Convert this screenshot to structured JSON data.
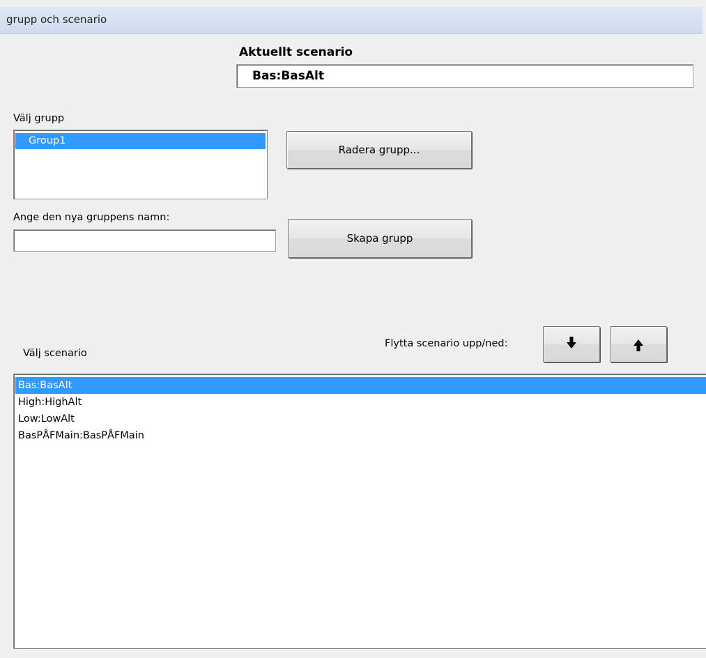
{
  "window": {
    "title": "grupp och scenario"
  },
  "current_scenario": {
    "label": "Aktuellt scenario",
    "value": "Bas:BasAlt"
  },
  "group": {
    "label": "Välj grupp",
    "items": [
      {
        "label": "Group1",
        "selected": true
      }
    ],
    "delete_button": "Radera grupp...",
    "new_name_label": "Ange den nya gruppens namn:",
    "new_name_value": "",
    "create_button": "Skapa grupp"
  },
  "scenario": {
    "label": "Välj scenario",
    "move_label": "Flytta scenario upp/ned:",
    "move_down_icon": "arrow-down-icon",
    "move_up_icon": "arrow-up-icon",
    "items": [
      {
        "label": "Bas:BasAlt",
        "selected": true
      },
      {
        "label": "High:HighAlt",
        "selected": false
      },
      {
        "label": "Low:LowAlt",
        "selected": false
      },
      {
        "label": "BasPÅFMain:BasPÅFMain",
        "selected": false
      }
    ]
  },
  "colors": {
    "selection": "#3399ff",
    "window_bg": "#f0f0f0",
    "titlebar": "#dfe8f5"
  }
}
